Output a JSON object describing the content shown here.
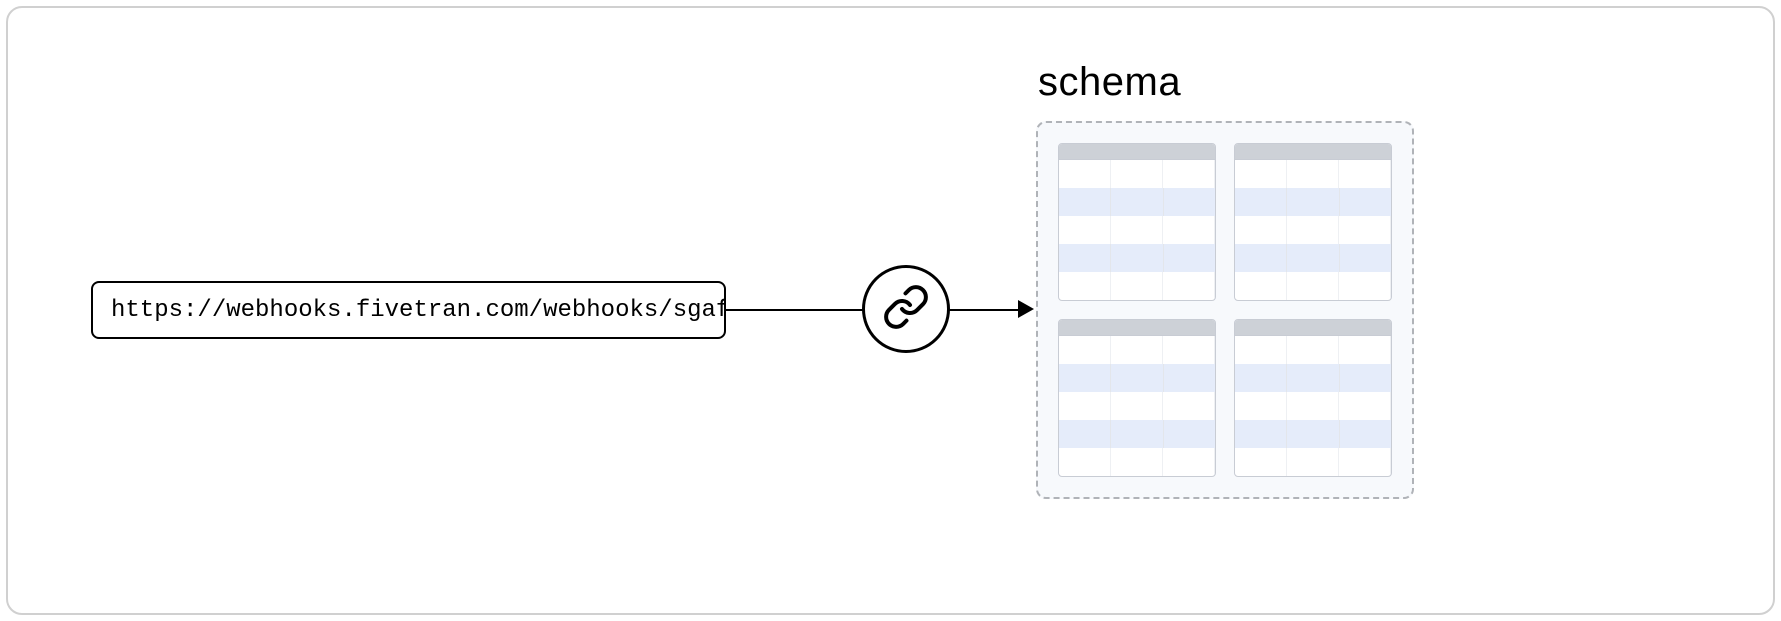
{
  "webhook": {
    "url": "https://webhooks.fivetran.com/webhooks/sgaf..."
  },
  "schema": {
    "label": "schema",
    "tables": [
      {
        "rows": 5,
        "cols": 3
      },
      {
        "rows": 5,
        "cols": 3
      },
      {
        "rows": 5,
        "cols": 3
      },
      {
        "rows": 5,
        "cols": 3
      }
    ]
  }
}
